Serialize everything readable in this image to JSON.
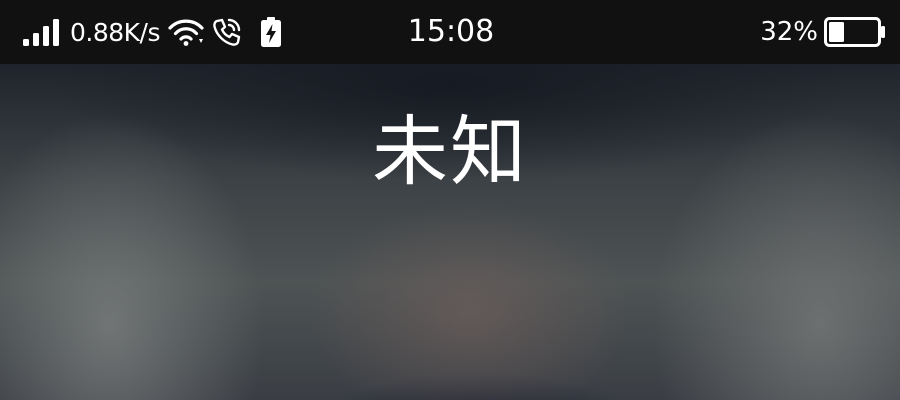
{
  "status_bar": {
    "signal_icon": "signal-bars-icon",
    "net_speed": "0.88K/s",
    "wifi_icon": "wifi-icon",
    "call_icon": "phone-call-icon",
    "charging_icon": "battery-charging-icon",
    "time": "15:08",
    "battery_percent": "32%",
    "battery_level": 0.32,
    "battery_icon": "battery-icon"
  },
  "call": {
    "caller_name": "未知"
  },
  "colors": {
    "status_bar_bg": "#111111",
    "text": "#ffffff"
  }
}
